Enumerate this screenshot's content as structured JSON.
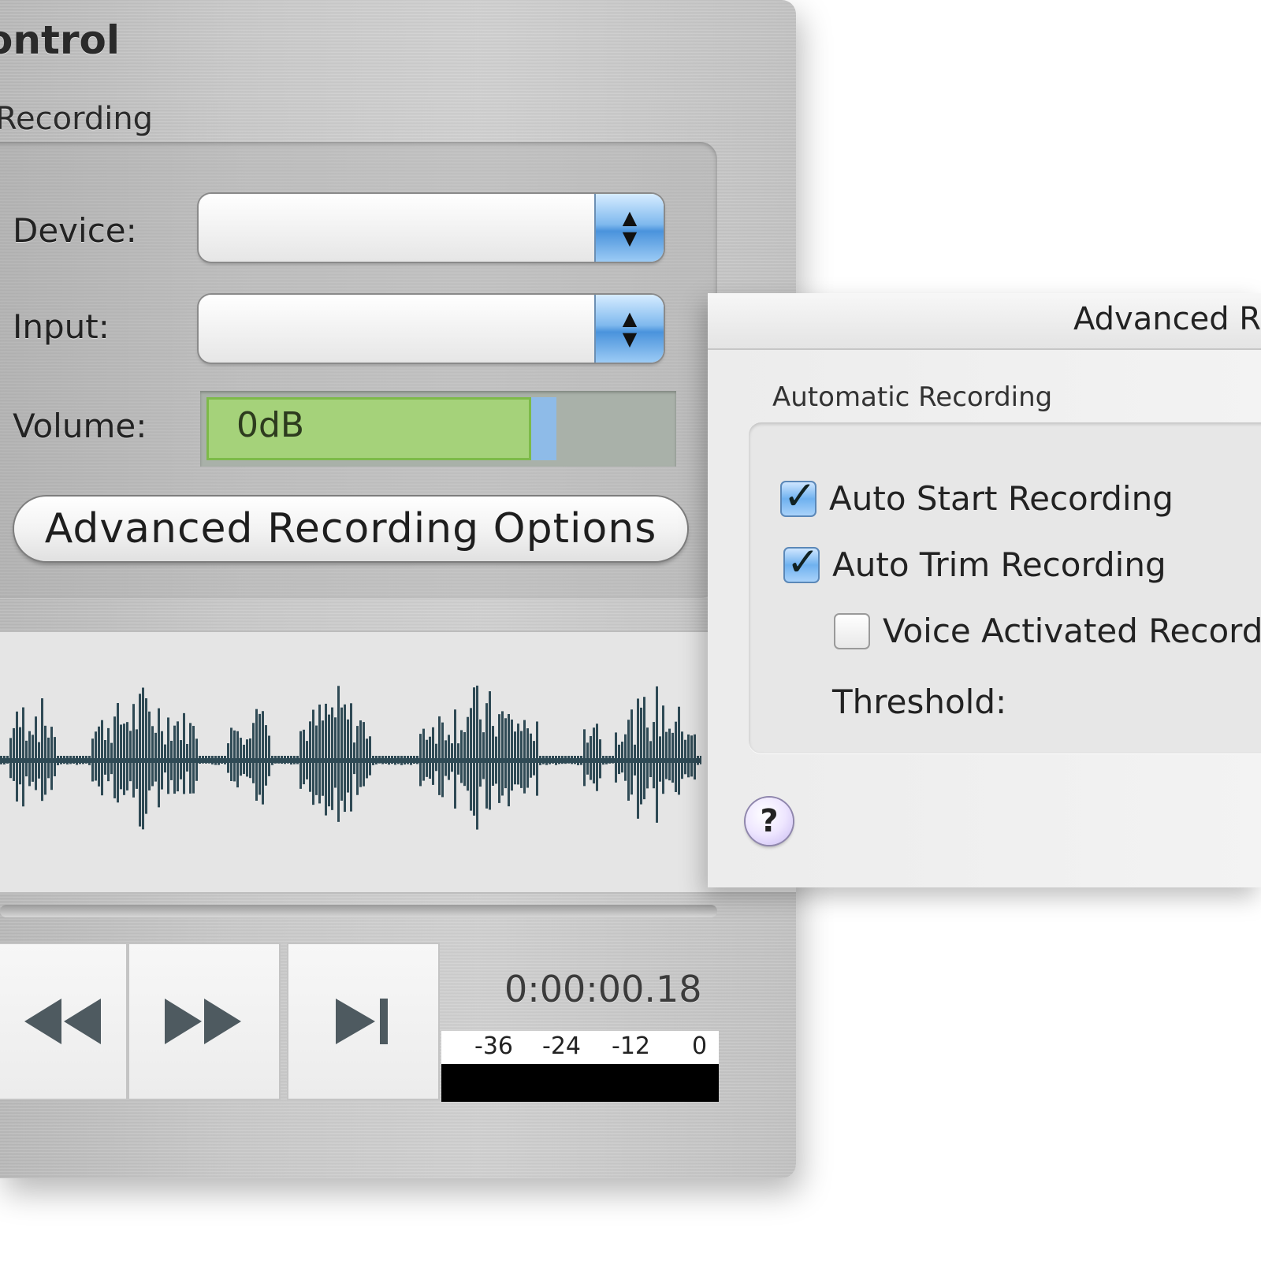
{
  "window": {
    "title": "ontrol"
  },
  "recording": {
    "section_label": "Recording",
    "device_label": "Device:",
    "device_value": "",
    "input_label": "Input:",
    "input_value": "",
    "volume_label": "Volume:",
    "volume_value": "0dB",
    "volume_fraction": 0.71,
    "advanced_button_label": "Advanced Recording Options"
  },
  "transport": {
    "time": "0:00:00.18",
    "meter_ticks": [
      "-36",
      "-24",
      "-12",
      "0"
    ],
    "buttons": [
      "rewind-icon",
      "fast-forward-icon",
      "skip-to-end-icon"
    ]
  },
  "advanced_panel": {
    "title": "Advanced R",
    "group_label": "Automatic Recording",
    "options": [
      {
        "label": "Auto Start Recording",
        "checked": true
      },
      {
        "label": "Auto Trim Recording",
        "checked": true
      },
      {
        "label": "Voice Activated Recordi",
        "checked": false
      }
    ],
    "threshold_label": "Threshold:",
    "help_label": "?"
  },
  "colors": {
    "volume_fill": "#a5d27a",
    "waveform": "#2f4a55",
    "popup_accent": "#4a93dc"
  }
}
